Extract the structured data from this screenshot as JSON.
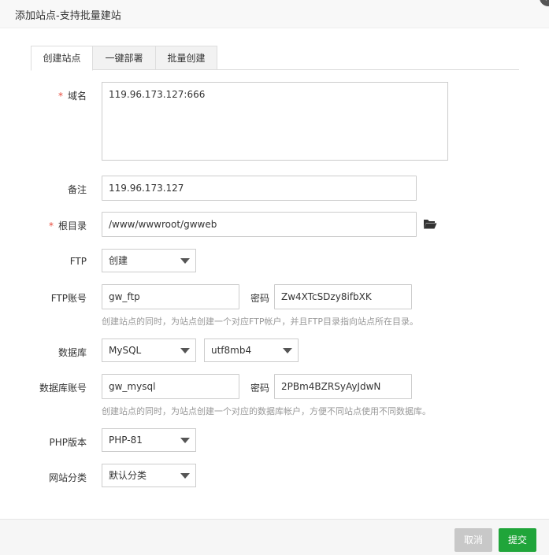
{
  "dialog": {
    "title": "添加站点-支持批量建站",
    "close_glyph": "×"
  },
  "tabs": [
    {
      "label": "创建站点",
      "active": true
    },
    {
      "label": "一键部署",
      "active": false
    },
    {
      "label": "批量创建",
      "active": false
    }
  ],
  "form": {
    "required_mark": "*",
    "domain": {
      "label": "域名",
      "value": "119.96.173.127:666"
    },
    "remark": {
      "label": "备注",
      "value": "119.96.173.127"
    },
    "root_dir": {
      "label": "根目录",
      "value": "/www/wwwroot/gwweb",
      "icon": "folder-open-icon"
    },
    "ftp": {
      "label": "FTP",
      "value": "创建"
    },
    "ftp_account": {
      "label": "FTP账号",
      "username": "gw_ftp",
      "password_label": "密码",
      "password": "Zw4XTcSDzy8ifbXK",
      "hint": "创建站点的同时，为站点创建一个对应FTP帐户，并且FTP目录指向站点所在目录。"
    },
    "database": {
      "label": "数据库",
      "type": "MySQL",
      "charset": "utf8mb4"
    },
    "db_account": {
      "label": "数据库账号",
      "username": "gw_mysql",
      "password_label": "密码",
      "password": "2PBm4BZRSyAyJdwN",
      "hint": "创建站点的同时，为站点创建一个对应的数据库帐户，方便不同站点使用不同数据库。"
    },
    "php_version": {
      "label": "PHP版本",
      "value": "PHP-81"
    },
    "site_category": {
      "label": "网站分类",
      "value": "默认分类"
    }
  },
  "footer": {
    "cancel_label": "取消",
    "submit_label": "提交"
  },
  "colors": {
    "accent_green": "#20a53a",
    "required_red": "#e84b3c",
    "disabled_gray": "#c8c8c8"
  }
}
